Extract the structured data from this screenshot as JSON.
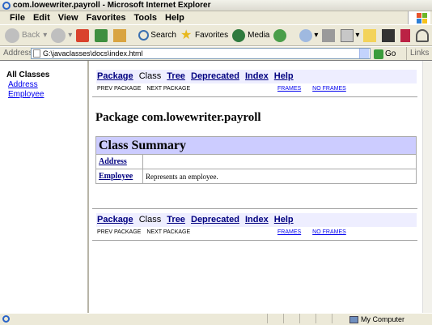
{
  "window": {
    "title": "com.lowewriter.payroll - Microsoft Internet Explorer"
  },
  "menu": [
    "File",
    "Edit",
    "View",
    "Favorites",
    "Tools",
    "Help"
  ],
  "toolbar": {
    "back": "Back",
    "search": "Search",
    "favorites": "Favorites",
    "media": "Media"
  },
  "address": {
    "label": "Address",
    "value": "G:\\javaclasses\\docs\\index.html",
    "go": "Go",
    "links": "Links"
  },
  "left_frame": {
    "heading": "All Classes",
    "classes": [
      "Address",
      "Employee"
    ]
  },
  "nav": {
    "package": "Package",
    "class": "Class",
    "tree": "Tree",
    "deprecated": "Deprecated",
    "index": "Index",
    "help": "Help",
    "prev_package": "PREV PACKAGE",
    "next_package": "NEXT PACKAGE",
    "frames": "FRAMES",
    "no_frames": "NO FRAMES"
  },
  "package_title": "Package com.lowewriter.payroll",
  "class_summary": {
    "heading": "Class Summary",
    "rows": [
      {
        "name": "Address",
        "description": ""
      },
      {
        "name": "Employee",
        "description": "Represents an employee."
      }
    ]
  },
  "status": {
    "zone": "My Computer"
  }
}
